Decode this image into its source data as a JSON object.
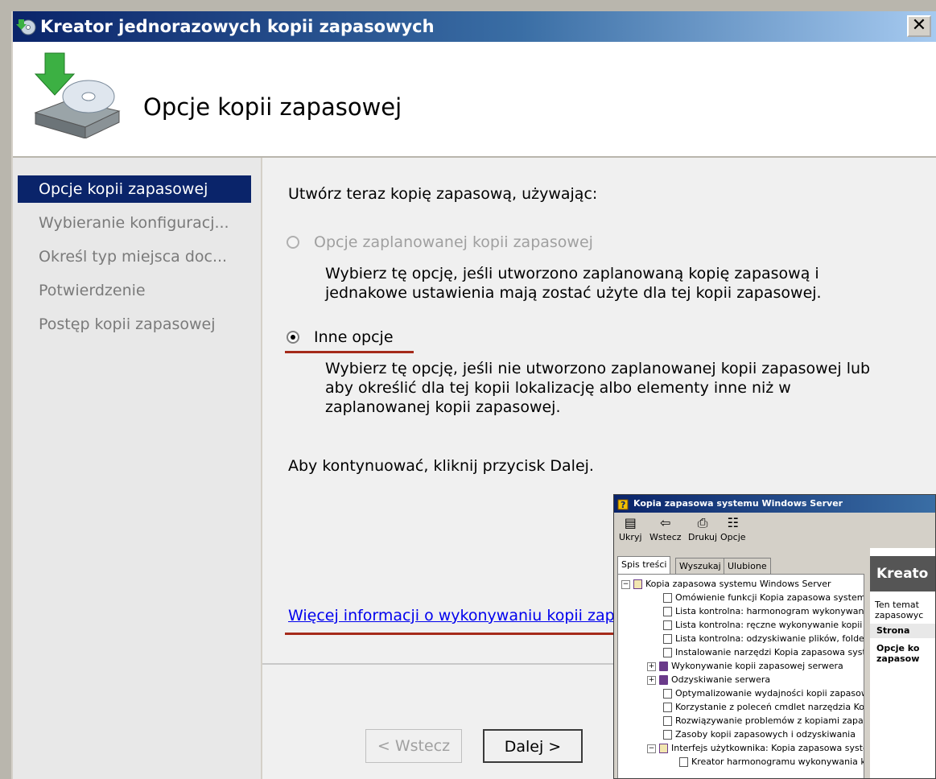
{
  "wizard": {
    "title": "Kreator jednorazowych kopii zapasowych",
    "close_glyph": "✕",
    "header_title": "Opcje kopii zapasowej",
    "nav": [
      {
        "label": "Opcje kopii zapasowej",
        "active": true
      },
      {
        "label": "Wybieranie konfiguracj...",
        "active": false
      },
      {
        "label": "Określ typ miejsca doc...",
        "active": false
      },
      {
        "label": "Potwierdzenie",
        "active": false
      },
      {
        "label": "Postęp kopii zapasowej",
        "active": false
      }
    ],
    "intro": "Utwórz teraz kopię zapasową, używając:",
    "option1": {
      "label": "Opcje zaplanowanej kopii zapasowej",
      "desc": "Wybierz tę opcję, jeśli utworzono zaplanowaną kopię zapasową i jednakowe ustawienia mają zostać użyte dla tej kopii zapasowej.",
      "selected": false,
      "enabled": false
    },
    "option2": {
      "label": "Inne opcje",
      "desc": "Wybierz tę opcję, jeśli nie utworzono zaplanowanej kopii zapasowej lub aby określić dla tej kopii lokalizację albo elementy inne niż w zaplanowanej kopii zapasowej.",
      "selected": true,
      "enabled": true
    },
    "continue_text": "Aby kontynuować, kliknij przycisk Dalej.",
    "more_link": "Więcej informacji o wykonywaniu kopii zap",
    "buttons": {
      "back": "< Wstecz",
      "next": "Dalej >"
    },
    "accent_color": "#a52a1a"
  },
  "help": {
    "title": "Kopia zapasowa systemu Windows Server",
    "toolbar": [
      {
        "label": "Ukryj",
        "icon": "hide-icon"
      },
      {
        "label": "Wstecz",
        "icon": "back-arrow-icon"
      },
      {
        "label": "Drukuj",
        "icon": "printer-icon"
      },
      {
        "label": "Opcje",
        "icon": "options-icon"
      }
    ],
    "tabs": [
      "Spis treści",
      "Wyszukaj",
      "Ulubione"
    ],
    "tree": [
      {
        "label": "Kopia zapasowa systemu Windows Server",
        "kind": "bookopen",
        "expander": "−",
        "level": 0
      },
      {
        "label": "Omówienie funkcji Kopia zapasowa systemu W",
        "kind": "page",
        "level": 2
      },
      {
        "label": "Lista kontrolna: harmonogram wykonywania k",
        "kind": "page",
        "level": 2
      },
      {
        "label": "Lista kontrolna: ręczne wykonywanie kopii za",
        "kind": "page",
        "level": 2
      },
      {
        "label": "Lista kontrolna: odzyskiwanie plików, folderów",
        "kind": "page",
        "level": 2
      },
      {
        "label": "Instalowanie narzędzi Kopia zapasowa systen",
        "kind": "page",
        "level": 2
      },
      {
        "label": "Wykonywanie kopii zapasowej serwera",
        "kind": "book",
        "expander": "+",
        "level": 1
      },
      {
        "label": "Odzyskiwanie serwera",
        "kind": "book",
        "expander": "+",
        "level": 1
      },
      {
        "label": "Optymalizowanie wydajności kopii zapasowyc",
        "kind": "page",
        "level": 2
      },
      {
        "label": "Korzystanie z poleceń cmdlet narzędzia Kopia",
        "kind": "page",
        "level": 2
      },
      {
        "label": "Rozwiązywanie problemów z kopiami zapaso",
        "kind": "page",
        "level": 2
      },
      {
        "label": "Zasoby kopii zapasowych i odzyskiwania",
        "kind": "page",
        "level": 2
      },
      {
        "label": "Interfejs użytkownika: Kopia zapasowa syster",
        "kind": "bookopen",
        "expander": "−",
        "level": 1
      },
      {
        "label": "Kreator harmonogramu wykonywania kop",
        "kind": "page",
        "level": 3
      }
    ],
    "right": {
      "band": "Kreato",
      "text_line1": "Ten temat",
      "text_line2": "zapasowyc",
      "col_header": "Strona",
      "cell_line1": "Opcje ko",
      "cell_line2": "zapasow"
    }
  }
}
